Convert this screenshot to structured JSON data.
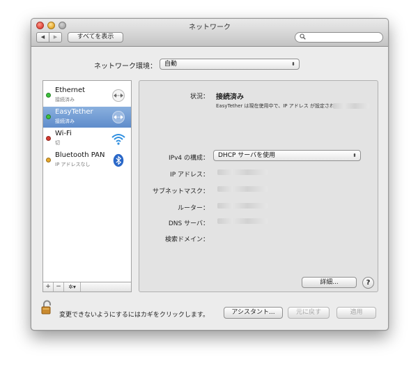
{
  "window": {
    "title": "ネットワーク"
  },
  "toolbar": {
    "back_label": "◀",
    "forward_label": "▶",
    "show_all_label": "すべてを表示",
    "search_placeholder": ""
  },
  "location": {
    "label": "ネットワーク環境：",
    "value": "自動"
  },
  "services": [
    {
      "name": "Ethernet",
      "status": "接続済み",
      "dot_color": "#3cc23c",
      "icon": "ethernet-arrows-icon"
    },
    {
      "name": "EasyTether",
      "status": "接続済み",
      "dot_color": "#3cc23c",
      "icon": "ethernet-arrows-icon",
      "selected": true
    },
    {
      "name": "Wi-Fi",
      "status": "切",
      "dot_color": "#d63a2f",
      "icon": "wifi-icon"
    },
    {
      "name": "Bluetooth PAN",
      "status": "IP アドレスなし",
      "dot_color": "#e8a82a",
      "icon": "bluetooth-icon"
    }
  ],
  "sidebar_controls": {
    "add_label": "+",
    "remove_label": "−",
    "gear_label": "✲▾"
  },
  "detail": {
    "status_label": "状況：",
    "status_value": "接続済み",
    "status_description": "EasyTether は現在使用中で、IP アドレス が設定されています。",
    "ipv4_label": "IPv4 の構成：",
    "ipv4_value": "DHCP サーバを使用",
    "ip_label": "IP アドレス：",
    "subnet_label": "サブネットマスク：",
    "router_label": "ルーター：",
    "dns_label": "DNS サーバ：",
    "search_domain_label": "検索ドメイン：",
    "advanced_label": "詳細...",
    "help_label": "?"
  },
  "footer": {
    "lock_text": "変更できないようにするにはカギをクリックします。",
    "assistant_label": "アシスタント...",
    "revert_label": "元に戻す",
    "apply_label": "適用"
  }
}
